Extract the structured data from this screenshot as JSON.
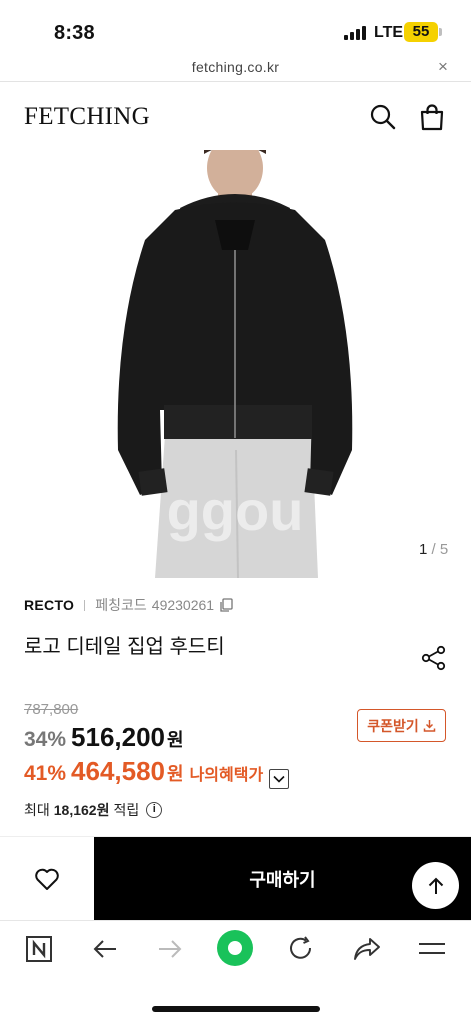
{
  "status": {
    "time": "8:38",
    "network": "LTE",
    "battery": "55"
  },
  "browser": {
    "url": "fetching.co.kr",
    "close": "×"
  },
  "header": {
    "logo": "FETCHING"
  },
  "gallery": {
    "current": "1",
    "total": "/ 5",
    "watermark": "ggou"
  },
  "product": {
    "brand": "RECTO",
    "code_label": "페칭코드",
    "code": "49230261",
    "title": "로고 디테일 집업 후드티",
    "original_price": "787,800",
    "discount": "34%",
    "price": "516,200",
    "won": "원",
    "benefit_discount": "41%",
    "benefit_price": "464,580",
    "benefit_label": "나의혜택가",
    "coupon_button": "쿠폰받기",
    "points_prefix": "최대",
    "points_amount": "18,162원",
    "points_suffix": "적립",
    "info_icon": "i"
  },
  "actions": {
    "buy": "구매하기"
  },
  "colors": {
    "accent": "#e35a25",
    "buy_bg": "#000000",
    "battery": "#f5d100"
  }
}
